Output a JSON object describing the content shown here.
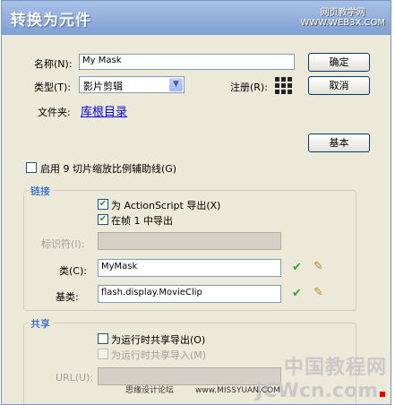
{
  "title": "转换为元件",
  "watermark_top": [
    "网页教学网",
    "WWW.WEB3X.COM"
  ],
  "name_label": "名称(N):",
  "name_value": "My Mask",
  "ok_button": "确定",
  "type_label": "类型(T):",
  "type_value": "影片剪辑",
  "registration_label": "注册(R):",
  "cancel_button": "取消",
  "folder_label": "文件夹:",
  "folder_link": "库根目录",
  "basic_button": "基本",
  "nine_slice_label": "启用 9 切片缩放比例辅助线(G)",
  "nine_slice_checked": false,
  "linkage": {
    "title": "链接",
    "export_as_label": "为 ActionScript 导出(X)",
    "export_as_checked": true,
    "export_first_frame_label": "在帧 1 中导出",
    "export_first_frame_checked": true,
    "identifier_label": "标识符(I):",
    "identifier_value": "",
    "class_label": "类(C):",
    "class_value": "MyMask",
    "base_class_label": "基类:",
    "base_class_value": "flash.display.MovieClip"
  },
  "sharing": {
    "title": "共享",
    "export_runtime_label": "为运行时共享导出(O)",
    "export_runtime_checked": false,
    "import_runtime_label": "为运行时共享导入(M)",
    "import_runtime_checked": false,
    "url_label": "URL(U):"
  },
  "watermark_bottom": {
    "line1": "中国教程网",
    "line2": "JCWcn.com",
    "small1": "思缘设计论坛",
    "small2": "www.MISSYUAN.COM"
  }
}
